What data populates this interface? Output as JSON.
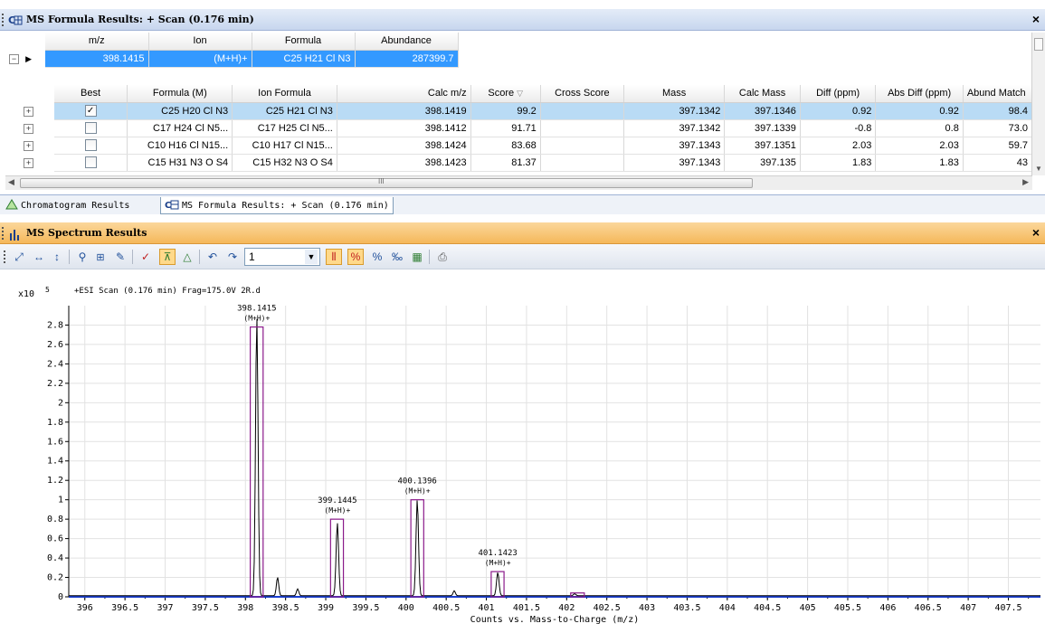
{
  "formula_panel": {
    "title": "MS Formula Results: + Scan (0.176 min)",
    "compound_headers": [
      "m/z",
      "Ion",
      "Formula",
      "Abundance"
    ],
    "compound_row": {
      "mz": "398.1415",
      "ion": "(M+H)+",
      "formula": "C25 H21 Cl N3",
      "abundance": "287399.7"
    },
    "result_headers": [
      "Best",
      "Formula (M)",
      "Ion Formula",
      "Calc m/z",
      "Score",
      "Cross Score",
      "Mass",
      "Calc Mass",
      "Diff (ppm)",
      "Abs Diff (ppm)",
      "Abund Match"
    ],
    "rows": [
      {
        "best": true,
        "formula": "C25 H20 Cl N3",
        "ion_formula": "C25 H21 Cl N3",
        "calc_mz": "398.1419",
        "score": "99.2",
        "cross": "",
        "mass": "397.1342",
        "calc_mass": "397.1346",
        "diff": "0.92",
        "abs_diff": "0.92",
        "abund": "98.4"
      },
      {
        "best": false,
        "formula": "C17 H24 Cl N5...",
        "ion_formula": "C17 H25 Cl N5...",
        "calc_mz": "398.1412",
        "score": "91.71",
        "cross": "",
        "mass": "397.1342",
        "calc_mass": "397.1339",
        "diff": "-0.8",
        "abs_diff": "0.8",
        "abund": "73.0"
      },
      {
        "best": false,
        "formula": "C10 H16 Cl N15...",
        "ion_formula": "C10 H17 Cl N15...",
        "calc_mz": "398.1424",
        "score": "83.68",
        "cross": "",
        "mass": "397.1343",
        "calc_mass": "397.1351",
        "diff": "2.03",
        "abs_diff": "2.03",
        "abund": "59.7"
      },
      {
        "best": false,
        "formula": "C15 H31 N3 O S4",
        "ion_formula": "C15 H32 N3 O S4",
        "calc_mz": "398.1423",
        "score": "81.37",
        "cross": "",
        "mass": "397.1343",
        "calc_mass": "397.135",
        "diff": "1.83",
        "abs_diff": "1.83",
        "abund": "43"
      }
    ],
    "scroll_marker": "III"
  },
  "tabs": {
    "chromatogram": "Chromatogram Results",
    "formula": "MS Formula Results: + Scan (0.176 min)"
  },
  "spectrum_panel": {
    "title": "MS Spectrum Results",
    "zoom_value": "1"
  },
  "icons": {
    "formula_panel": "formula-grid-icon",
    "spectrum_panel": "bar-chart-icon",
    "chromatogram_tab": "triangle-peak-icon"
  },
  "colors": {
    "selected_row": "#3399ff",
    "best_row": "#b9dbf5",
    "spectrum_header": "#f5b85a",
    "formula_header": "#c7d6ee",
    "peak_box": "#8b1a8b"
  },
  "chart_data": {
    "type": "line",
    "scale_label": "x10",
    "scale_exp": "5",
    "scan_label": "+ESI Scan (0.176 min) Frag=175.0V 2R.d",
    "xlabel": "Counts vs. Mass-to-Charge (m/z)",
    "xlim": [
      395.8,
      407.9
    ],
    "ylim": [
      0,
      3.0
    ],
    "x_ticks": [
      "396",
      "396.5",
      "397",
      "397.5",
      "398",
      "398.5",
      "399",
      "399.5",
      "400",
      "400.5",
      "401",
      "401.5",
      "402",
      "402.5",
      "403",
      "403.5",
      "404",
      "404.5",
      "405",
      "405.5",
      "406",
      "406.5",
      "407",
      "407.5"
    ],
    "y_ticks": [
      "0",
      "0.2",
      "0.4",
      "0.6",
      "0.8",
      "1",
      "1.2",
      "1.4",
      "1.6",
      "1.8",
      "2",
      "2.2",
      "2.4",
      "2.6",
      "2.8"
    ],
    "peaks": [
      {
        "mz": 398.1415,
        "height": 2.87,
        "label": "398.1415",
        "ion": "(M+H)+",
        "box_x": [
          398.06,
          398.22
        ],
        "box_top": 2.78
      },
      {
        "mz": 399.1445,
        "height": 0.75,
        "label": "399.1445",
        "ion": "(M+H)+",
        "box_x": [
          399.06,
          399.22
        ],
        "box_top": 0.8
      },
      {
        "mz": 400.1396,
        "height": 0.99,
        "label": "400.1396",
        "ion": "(M+H)+",
        "box_x": [
          400.06,
          400.22
        ],
        "box_top": 1.0
      },
      {
        "mz": 401.1423,
        "height": 0.24,
        "label": "401.1423",
        "ion": "(M+H)+",
        "box_x": [
          401.06,
          401.22
        ],
        "box_top": 0.26
      }
    ],
    "minor_peaks": [
      {
        "mz": 398.4,
        "height": 0.19
      },
      {
        "mz": 398.65,
        "height": 0.07
      },
      {
        "mz": 400.6,
        "height": 0.05
      },
      {
        "mz": 402.1,
        "height": 0.02
      }
    ],
    "small_box": {
      "box_x": [
        402.05,
        402.22
      ],
      "box_top": 0.04
    }
  }
}
